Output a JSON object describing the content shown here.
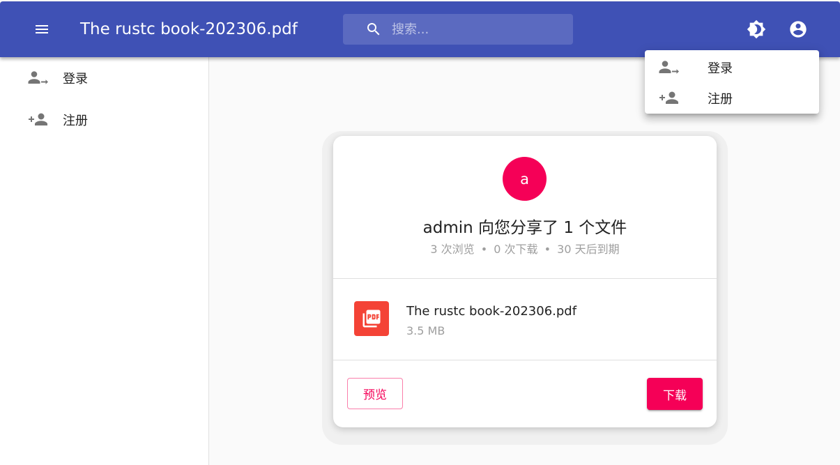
{
  "appbar": {
    "title": "The rustc book-202306.pdf",
    "menu_icon": "menu-icon",
    "search": {
      "placeholder": "搜索...",
      "value": "",
      "icon": "search-icon"
    },
    "theme_icon": "brightness-icon",
    "account_icon": "account-circle-icon",
    "color": "#3f51b5"
  },
  "sidebar": {
    "items": [
      {
        "label": "登录",
        "icon": "login-person-icon"
      },
      {
        "label": "注册",
        "icon": "person-add-icon"
      }
    ]
  },
  "account_menu": {
    "items": [
      {
        "label": "登录",
        "icon": "login-person-icon"
      },
      {
        "label": "注册",
        "icon": "person-add-icon"
      }
    ]
  },
  "share": {
    "avatar_letter": "a",
    "avatar_color": "#f50057",
    "title": "admin 向您分享了 1 个文件",
    "meta": {
      "views": "3 次浏览",
      "downloads": "0 次下载",
      "expire": "30 天后到期",
      "separator": "•"
    },
    "file": {
      "name": "The rustc book-202306.pdf",
      "size": "3.5 MB",
      "icon": "pdf-file-icon",
      "icon_color": "#f44336"
    },
    "preview_label": "预览",
    "download_label": "下载",
    "accent_color": "#f50057"
  }
}
